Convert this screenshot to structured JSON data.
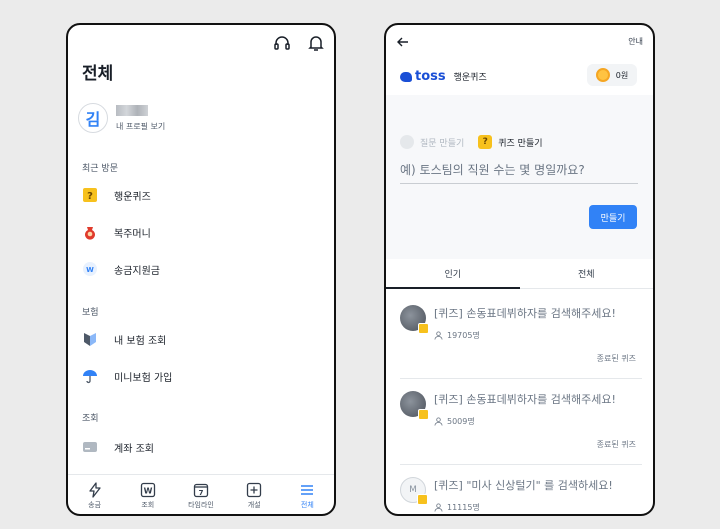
{
  "left": {
    "title": "전체",
    "profile": {
      "avatar_letter": "김",
      "link": "내 프로필 보기"
    },
    "sections": {
      "recent": "최근 방문",
      "insurance": "보험",
      "lookup": "조회"
    },
    "recent_items": [
      {
        "label": "행운퀴즈",
        "icon": "quiz-icon"
      },
      {
        "label": "복주머니",
        "icon": "lucky-pouch-icon"
      },
      {
        "label": "송금지원금",
        "icon": "transfer-support-icon"
      }
    ],
    "insurance_items": [
      {
        "label": "내 보험 조회",
        "icon": "insurance-shield-icon"
      },
      {
        "label": "미니보험 가입",
        "icon": "umbrella-icon"
      }
    ],
    "lookup_items": [
      {
        "label": "계좌 조회",
        "icon": "account-card-icon"
      }
    ],
    "tabs": [
      {
        "label": "송금",
        "icon": "lightning-icon"
      },
      {
        "label": "조회",
        "icon": "won-icon"
      },
      {
        "label": "타임라인",
        "icon": "calendar-icon"
      },
      {
        "label": "개설",
        "icon": "plus-box-icon"
      },
      {
        "label": "전체",
        "icon": "menu-icon"
      }
    ],
    "active_tab": "전체"
  },
  "right": {
    "guide": "안내",
    "brand": "toss",
    "app_name": "행운퀴즈",
    "coin_amount": "0원",
    "mode_question": "질문 만들기",
    "mode_quiz_mark": "?",
    "mode_quiz": "퀴즈 만들기",
    "input_placeholder": "예) 토스팀의 직원 수는 몇 명일까요?",
    "make_button": "만들기",
    "tabs": [
      "인기",
      "전체"
    ],
    "quizzes": [
      {
        "title": "[퀴즈] 손동표데뷔하자를 검색해주세요!",
        "count": "19705명",
        "status": "종료된 퀴즈"
      },
      {
        "title": "[퀴즈] 손동표데뷔하자를 검색해주세요!",
        "count": "5009명",
        "status": "종료된 퀴즈"
      },
      {
        "title": "[퀴즈] \"미사 신상털기\" 를 검색하세요!",
        "count": "11115명",
        "avatar_letter": "M"
      }
    ],
    "colors": {
      "accent": "#3182f6",
      "brand": "#1a4fd6",
      "quiz_yellow": "#f7c11d"
    }
  }
}
